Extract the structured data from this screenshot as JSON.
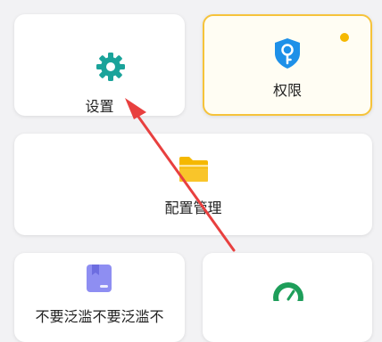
{
  "cards": {
    "settings": {
      "label": "设置",
      "icon": "gear-icon",
      "color": "#1aa39a"
    },
    "permissions": {
      "label": "权限",
      "icon": "key-shield-icon",
      "color": "#1e90e8",
      "highlight": "#f6c33a",
      "badge_color": "#f5b800"
    },
    "config": {
      "label": "配置管理",
      "icon": "folder-icon",
      "color": "#f5b800"
    },
    "doc": {
      "label": "不要泛滥不要泛滥不",
      "icon": "document-icon",
      "color": "#8e8ef2"
    },
    "speed": {
      "icon": "speedometer-icon",
      "color": "#1e9e5a"
    }
  },
  "annotation": {
    "type": "arrow",
    "color": "#e8403f"
  }
}
